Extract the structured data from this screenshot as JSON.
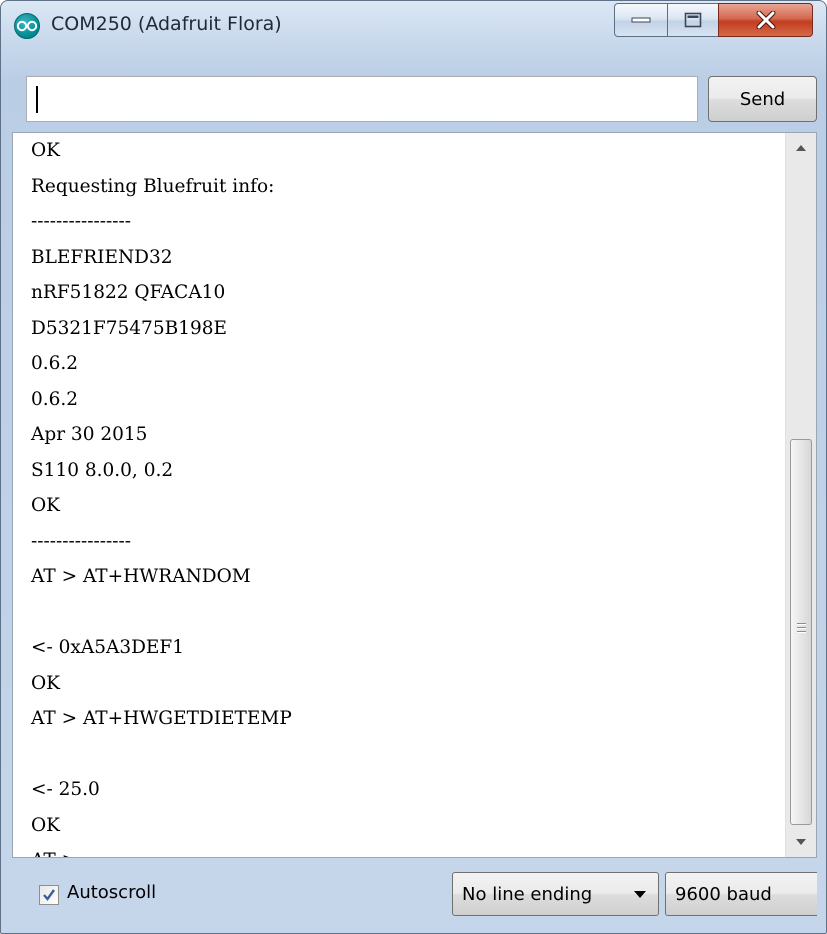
{
  "window": {
    "title": "COM250 (Adafruit Flora)",
    "app_icon": "arduino-icon",
    "controls": [
      "minimize-icon",
      "maximize-icon",
      "close-icon"
    ]
  },
  "input": {
    "value": "",
    "send_label": "Send"
  },
  "output": {
    "lines": [
      "OK",
      "Requesting Bluefruit info:",
      "----------------",
      "BLEFRIEND32",
      "nRF51822 QFACA10",
      "D5321F75475B198E",
      "0.6.2",
      "0.6.2",
      "Apr 30 2015",
      "S110 8.0.0, 0.2",
      "OK",
      "----------------",
      "AT > AT+HWRANDOM",
      "",
      "<- 0xA5A3DEF1",
      "OK",
      "AT > AT+HWGETDIETEMP",
      "",
      "<- 25.0",
      "OK",
      "AT >"
    ],
    "scroll_position": 0.82
  },
  "footer": {
    "autoscroll_label": "Autoscroll",
    "autoscroll_checked": true,
    "line_ending": "No line ending",
    "baud": "9600 baud"
  }
}
